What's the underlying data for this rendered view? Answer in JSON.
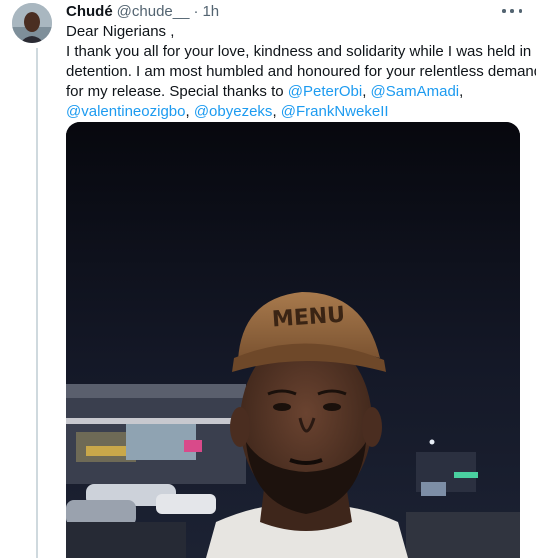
{
  "tweet": {
    "author_name": "Chudé",
    "author_handle": "@chude__",
    "separator": "·",
    "timestamp": "1h",
    "more_icon": "more-horizontal-icon",
    "text": {
      "line1": "Dear Nigerians ,",
      "line2": "I thank you all for your love, kindness and solidarity while I was held in",
      "line3": "detention. I am most humbled and honoured for your relentless demand",
      "line4_prefix": "for my release. Special thanks to ",
      "mentions": [
        "@PeterObi",
        "@SamAmadi",
        "@valentineozigbo",
        "@obyezeks",
        "@FrankNwekeII"
      ],
      "comma": ", "
    },
    "photo": {
      "cap_text": "MENU"
    }
  },
  "colors": {
    "link": "#1d9bf0",
    "secondary_text": "#536471",
    "primary_text": "#0f1419"
  }
}
